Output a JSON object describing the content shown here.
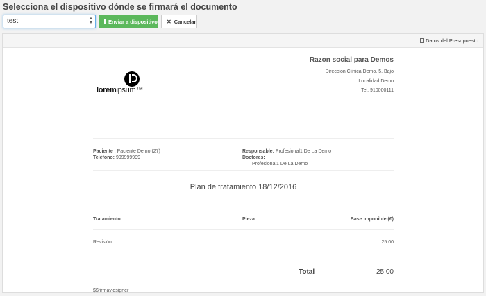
{
  "heading": "Selecciona el dispositivo dónde se firmará el documento",
  "toolbar": {
    "device_select_value": "test",
    "send_label": "Enviar a dispositivo",
    "cancel_label": "Cancelar"
  },
  "panel": {
    "budget_link": "Datos del Presupuesto"
  },
  "company": {
    "name": "Razon social para Demos",
    "address": "Direccion Clinica Demo, 5, Bajo",
    "locality": "Localidad Demo",
    "phone": "Tel. 910000111"
  },
  "logo": {
    "word_bold": "lorem",
    "word_light": "ipsum",
    "tm": "™"
  },
  "patient": {
    "patient_label": "Paciente",
    "patient_value": "Paciente Demo (27)",
    "phone_label": "Teléfono:",
    "phone_value": "999999999"
  },
  "staff": {
    "responsible_label": "Responsable:",
    "responsible_value": "Profesional1 De La Demo",
    "doctors_label": "Doctores:",
    "doctor_1": "Profesional1 De La Demo"
  },
  "plan_title": "Plan de tratamiento 18/12/2016",
  "table": {
    "headers": [
      "Tratamiento",
      "Pieza",
      "Base imponible (€)"
    ],
    "rows": [
      {
        "tratamiento": "Revisión",
        "pieza": "",
        "base": "25.00"
      }
    ]
  },
  "total": {
    "label": "Total",
    "value": "25.00"
  },
  "signature_placeholder": "$$firmavidsigner",
  "colors": {
    "primary_green": "#5cb85c",
    "focus_blue": "#66afe9"
  }
}
